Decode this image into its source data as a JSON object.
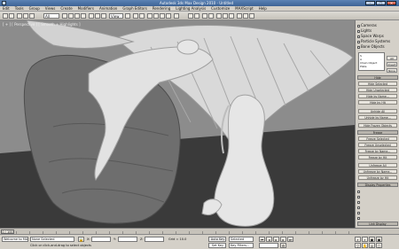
{
  "window": {
    "title": "Autodesk 3ds Max Design 2010 - Untitled"
  },
  "menus": [
    "Edit",
    "Tools",
    "Group",
    "Views",
    "Create",
    "Modifiers",
    "Animation",
    "Graph Editors",
    "Rendering",
    "Lighting Analysis",
    "Customize",
    "MAXScript",
    "Help"
  ],
  "toolbar": {
    "selection_filter": "All",
    "ref_coord": "View"
  },
  "viewport": {
    "label": "[ + ] [ Perspective ] [ Smooth + Highlights ]",
    "colors": {
      "background": "#8c8c8c",
      "ground": "#3a3a3a",
      "model": "#cfcfcf"
    }
  },
  "command_panel": {
    "checkboxes": [
      "Cameras",
      "Lights",
      "Space Warps",
      "Particle Systems",
      "Bone Objects"
    ],
    "all_button": "All",
    "none_button": "None",
    "invert_button": "Invert",
    "list_items": [
      "S",
      "A",
      "Chain Object",
      "Plate"
    ],
    "hide_header": "Hide",
    "hide_buttons": [
      "Hide Selected",
      "Hide Unselected",
      "Hide by Name...",
      "Hide by Hit",
      "Unhide All",
      "Unhide by Name...",
      "Hide Frozen Objects"
    ],
    "freeze_header": "Freeze",
    "freeze_buttons": [
      "Freeze Selected",
      "Freeze Unselected",
      "Freeze by Name...",
      "Freeze by Hit",
      "Unfreeze All",
      "Unfreeze by Name...",
      "Unfreeze by Hit"
    ],
    "display_props_header": "Display Properties",
    "link_display_header": "Link Display"
  },
  "timeline": {
    "frame": "0 / 100",
    "tick_labels": [
      "0",
      "5",
      "10",
      "15",
      "20",
      "25",
      "30",
      "35",
      "40",
      "45",
      "50",
      "55",
      "60",
      "65",
      "70",
      "75",
      "80",
      "85",
      "90",
      "95",
      "100"
    ]
  },
  "status": {
    "selection": "None Selected",
    "prompt": "Click or click-and-drag to select objects",
    "x_label": "X:",
    "y_label": "Y:",
    "z_label": "Z:",
    "grid": "Grid = 10.0",
    "auto_key": "Auto Key",
    "set_key": "Set Key",
    "key_filters": "Key Filters...",
    "selected_dropdown": "Selected",
    "maxscript_prompt": "Welcome to MAXScript."
  }
}
